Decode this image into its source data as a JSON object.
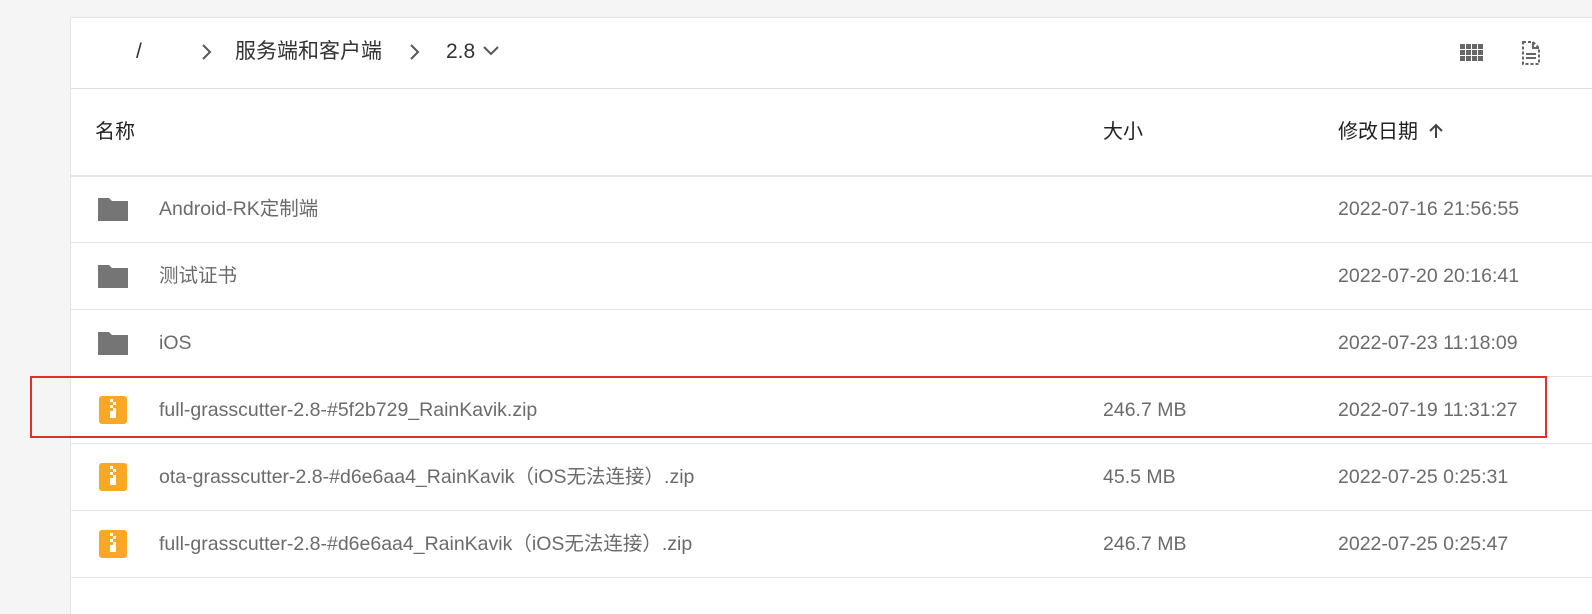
{
  "breadcrumb": {
    "root": "/",
    "folder": "服务端和客户端",
    "current": "2.8"
  },
  "toolbar": {
    "grid_icon": "grid-view-icon",
    "doc_icon": "file-info-icon"
  },
  "header": {
    "name": "名称",
    "size": "大小",
    "date": "修改日期"
  },
  "colors": {
    "folder": "#757575",
    "zip": "#f9a825",
    "highlight": "#e0302b"
  },
  "rows": [
    {
      "type": "folder",
      "name": "Android-RK定制端",
      "size": "",
      "date": "2022-07-16 21:56:55"
    },
    {
      "type": "folder",
      "name": "测试证书",
      "size": "",
      "date": "2022-07-20 20:16:41"
    },
    {
      "type": "folder",
      "name": "iOS",
      "size": "",
      "date": "2022-07-23 11:18:09"
    },
    {
      "type": "zip",
      "name": "full-grasscutter-2.8-#5f2b729_RainKavik.zip",
      "size": "246.7 MB",
      "date": "2022-07-19 11:31:27"
    },
    {
      "type": "zip",
      "name": "ota-grasscutter-2.8-#d6e6aa4_RainKavik（iOS无法连接）.zip",
      "size": "45.5 MB",
      "date": "2022-07-25 0:25:31"
    },
    {
      "type": "zip",
      "name": "full-grasscutter-2.8-#d6e6aa4_RainKavik（iOS无法连接）.zip",
      "size": "246.7 MB",
      "date": "2022-07-25 0:25:47"
    }
  ]
}
